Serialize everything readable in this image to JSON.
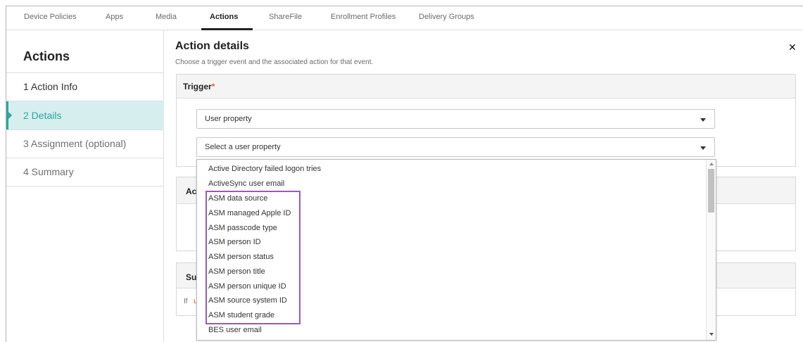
{
  "tabs": [
    {
      "label": "Device Policies"
    },
    {
      "label": "Apps"
    },
    {
      "label": "Media"
    },
    {
      "label": "Actions"
    },
    {
      "label": "ShareFile"
    },
    {
      "label": "Enrollment Profiles"
    },
    {
      "label": "Delivery Groups"
    }
  ],
  "sidebar": {
    "title": "Actions",
    "items": [
      {
        "label": "1 Action Info"
      },
      {
        "label": "2 Details"
      },
      {
        "label": "3 Assignment (optional)"
      },
      {
        "label": "4 Summary"
      }
    ]
  },
  "main": {
    "title": "Action details",
    "subtitle": "Choose a trigger event and the associated action for that event.",
    "trigger": {
      "header": "Trigger",
      "required_mark": "*",
      "event_select": "User property",
      "property_select": "Select a user property"
    },
    "action_panel_fragment": "Ac",
    "summary_panel_fragment": "Su",
    "summary_text_fragment": "If",
    "summary_red_fragment": "u"
  },
  "dropdown": {
    "options": [
      "Active Directory failed logon tries",
      "ActiveSync user email",
      "ASM data source",
      "ASM managed Apple ID",
      "ASM passcode type",
      "ASM person ID",
      "ASM person status",
      "ASM person title",
      "ASM person unique ID",
      "ASM source system ID",
      "ASM student grade",
      "BES user email"
    ]
  },
  "colors": {
    "accent": "#2aa7a0",
    "active_bg": "#d6efee",
    "required": "#e0603c",
    "highlight": "#9b59b6"
  },
  "icons": [
    "close-icon",
    "chevron-down-icon",
    "scroll-up-icon",
    "scroll-down-icon"
  ]
}
